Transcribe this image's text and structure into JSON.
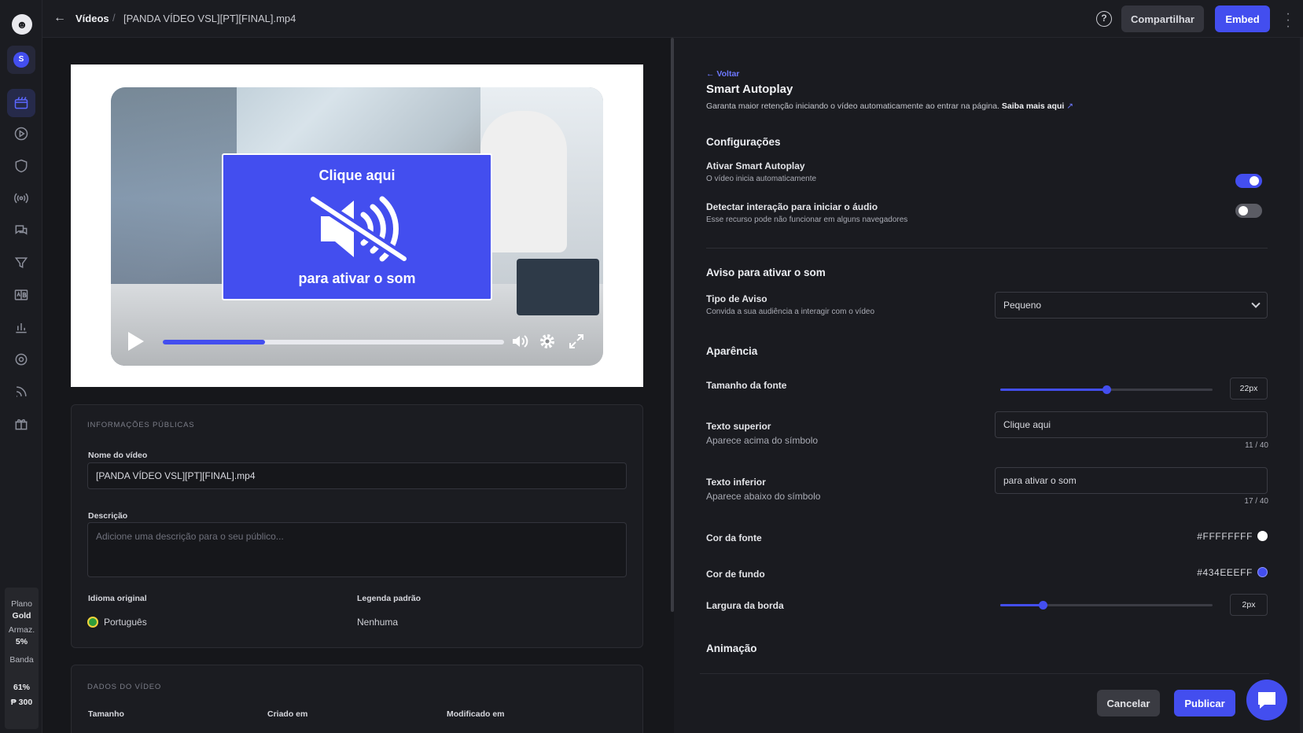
{
  "sidebar": {
    "workspace_initial": "S",
    "plan": {
      "plan_label": "Plano",
      "plan_value": "Gold",
      "storage_label": "Armaz.",
      "storage_value": "5%",
      "band_label": "Banda",
      "band_value": "61%",
      "credits": "₱ 300"
    },
    "nav_icons": [
      "videos-icon",
      "play-icon",
      "shield-icon",
      "broadcast-icon",
      "chat-icon",
      "filter-icon",
      "ab-test-icon",
      "chart-icon",
      "settings-icon",
      "rss-icon",
      "gift-icon"
    ]
  },
  "topbar": {
    "crumb_root": "Vídeos",
    "crumb_sep": "/",
    "crumb_file": "[PANDA VÍDEO VSL][PT][FINAL].mp4",
    "share_label": "Compartilhar",
    "embed_label": "Embed",
    "help_glyph": "?"
  },
  "player": {
    "overlay_top": "Clique aqui",
    "overlay_bottom": "para ativar o som",
    "progress": 0.3
  },
  "public_info": {
    "caption": "INFORMAÇÕES PÚBLICAS",
    "name_label": "Nome do vídeo",
    "name_value": "[PANDA VÍDEO VSL][PT][FINAL].mp4",
    "desc_label": "Descrição",
    "desc_placeholder": "Adicione uma descrição para o seu público...",
    "lang_label": "Idioma original",
    "lang_value": "Português",
    "subtitle_label": "Legenda padrão",
    "subtitle_value": "Nenhuma"
  },
  "video_data": {
    "caption": "DADOS DO VÍDEO",
    "col_size": "Tamanho",
    "col_created": "Criado em",
    "col_modified": "Modificado em"
  },
  "settings": {
    "back": "← Voltar",
    "title": "Smart Autoplay",
    "subtitle": "Garanta maior retenção iniciando o vídeo automaticamente ao entrar na página.",
    "learn_more": "Saiba mais aqui",
    "config_heading": "Configurações",
    "autoplay_label": "Ativar Smart Autoplay",
    "autoplay_desc": "O vídeo inicia automaticamente",
    "autoplay_on": true,
    "detect_label": "Detectar interação para iniciar o áudio",
    "detect_desc": "Esse recurso pode não funcionar em alguns navegadores",
    "detect_on": false,
    "warning_heading": "Aviso para ativar o som",
    "type_label": "Tipo de Aviso",
    "type_desc": "Convida a sua audiência a interagir com o vídeo",
    "type_value": "Pequeno",
    "appearance_heading": "Aparência",
    "font_size_label": "Tamanho da fonte",
    "font_size_value": "22px",
    "font_size_level": 0.5,
    "top_text_label": "Texto superior",
    "top_text_desc": "Aparece acima do símbolo",
    "top_text_value": "Clique aqui",
    "top_text_count": "11 / 40",
    "bottom_text_label": "Texto inferior",
    "bottom_text_desc": "Aparece abaixo do símbolo",
    "bottom_text_value": "para ativar o som",
    "bottom_text_count": "17 / 40",
    "font_color_label": "Cor da fonte",
    "font_color_value": "#FFFFFFFF",
    "bg_color_label": "Cor de fundo",
    "bg_color_value": "#434EEEFF",
    "border_label": "Largura da borda",
    "border_value": "2px",
    "border_level": 0.2,
    "animation_heading": "Animação",
    "cancel_label": "Cancelar",
    "publish_label": "Publicar"
  },
  "colors": {
    "accent": "#434eef",
    "font_swatch": "#ffffff",
    "bg_swatch": "#434eef"
  }
}
